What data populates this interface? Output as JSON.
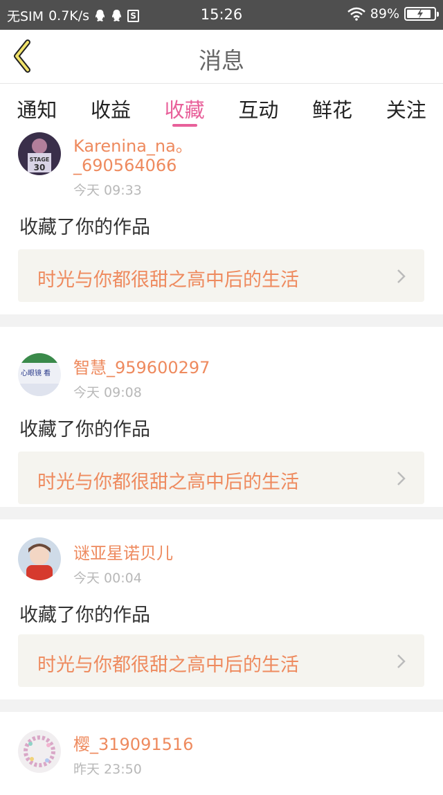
{
  "status_bar": {
    "carrier": "无SIM",
    "net_speed": "0.7K/s",
    "time": "15:26",
    "battery": "89%",
    "battery_level": 0.89,
    "icons": [
      "qq-icon",
      "qq-icon",
      "s-icon",
      "wifi-icon",
      "battery-icon"
    ]
  },
  "nav": {
    "title": "消息",
    "back_icon": "chevron-left-icon"
  },
  "tabs": [
    {
      "label": "通知"
    },
    {
      "label": "收益"
    },
    {
      "label": "收藏",
      "active": true
    },
    {
      "label": "互动"
    },
    {
      "label": "鲜花"
    },
    {
      "label": "关注"
    }
  ],
  "colors": {
    "accent_pink": "#e8609a",
    "username_orange": "#ee8a5e",
    "work_box_bg": "#f5f4ef",
    "status_bar_bg": "#4f4f4f"
  },
  "messages": [
    {
      "username_line1": "Karenina_na。",
      "username_line2": "_690564066",
      "time": "今天 09:33",
      "action": "收藏了你的作品",
      "work_title": "时光与你都很甜之高中后的生活"
    },
    {
      "username_line1": "智慧_959600297",
      "time": "今天 09:08",
      "action": "收藏了你的作品",
      "work_title": "时光与你都很甜之高中后的生活"
    },
    {
      "username_line1": "谜亚星诺贝儿",
      "time": "今天 00:04",
      "action": "收藏了你的作品",
      "work_title": "时光与你都很甜之高中后的生活"
    },
    {
      "username_line1": "樱_319091516",
      "time": "昨天 23:50"
    }
  ]
}
